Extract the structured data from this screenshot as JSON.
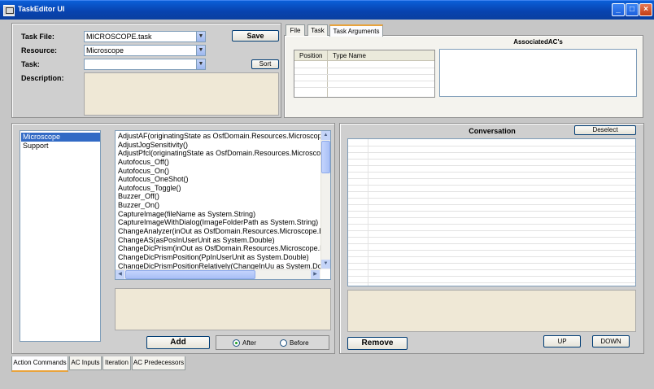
{
  "window": {
    "title": "TaskEditor UI"
  },
  "task_form": {
    "task_file_label": "Task File:",
    "task_file_value": "MICROSCOPE.task",
    "resource_label": "Resource:",
    "resource_value": "Microscope",
    "task_label": "Task:",
    "task_value": "",
    "description_label": "Description:",
    "save_label": "Save",
    "sort_label": "Sort"
  },
  "top_tabs": [
    "File",
    "Task",
    "Task Arguments"
  ],
  "arguments_table": {
    "col_position": "Position",
    "col_type_name": "Type Name"
  },
  "associated_title": "AssociatedAC's",
  "resource_list": [
    "Microscope",
    "Support"
  ],
  "methods": [
    "AdjustAF(originatingState as OsfDomain.Resources.Microscop",
    "AdjustJogSensitivity()",
    "AdjustPfcl(originatingState as OsfDomain.Resources.Microscop",
    "Autofocus_Off()",
    "Autofocus_On()",
    "Autofocus_OneShot()",
    "Autofocus_Toggle()",
    "Buzzer_Off()",
    "Buzzer_On()",
    "CaptureImage(fileName as System.String)",
    "CaptureImageWithDialog(ImageFolderPath as System.String)",
    "ChangeAnalyzer(inOut as OsfDomain.Resources.Microscope.E",
    "ChangeAS(asPosInUserUnit as System.Double)",
    "ChangeDicPrism(inOut as OsfDomain.Resources.Microscope.E",
    "ChangeDicPrismPosition(PpInUserUnit as System.Double)",
    "ChangeDicPrismPositionRelatively(ChangeInUu as System.Do"
  ],
  "add_label": "Add",
  "position_radios": {
    "after": "After",
    "before": "Before",
    "selected": "After"
  },
  "conversation": {
    "title": "Conversation",
    "deselect_label": "Deselect",
    "remove_label": "Remove",
    "up_label": "UP",
    "down_label": "DOWN"
  },
  "bottom_tabs": [
    "Action Commands",
    "AC Inputs",
    "Iteration",
    "AC Predecessors"
  ],
  "colors": {
    "titlebar": "#0a4fd0",
    "selection": "#316ac5",
    "beige_box": "#efe8d6"
  }
}
